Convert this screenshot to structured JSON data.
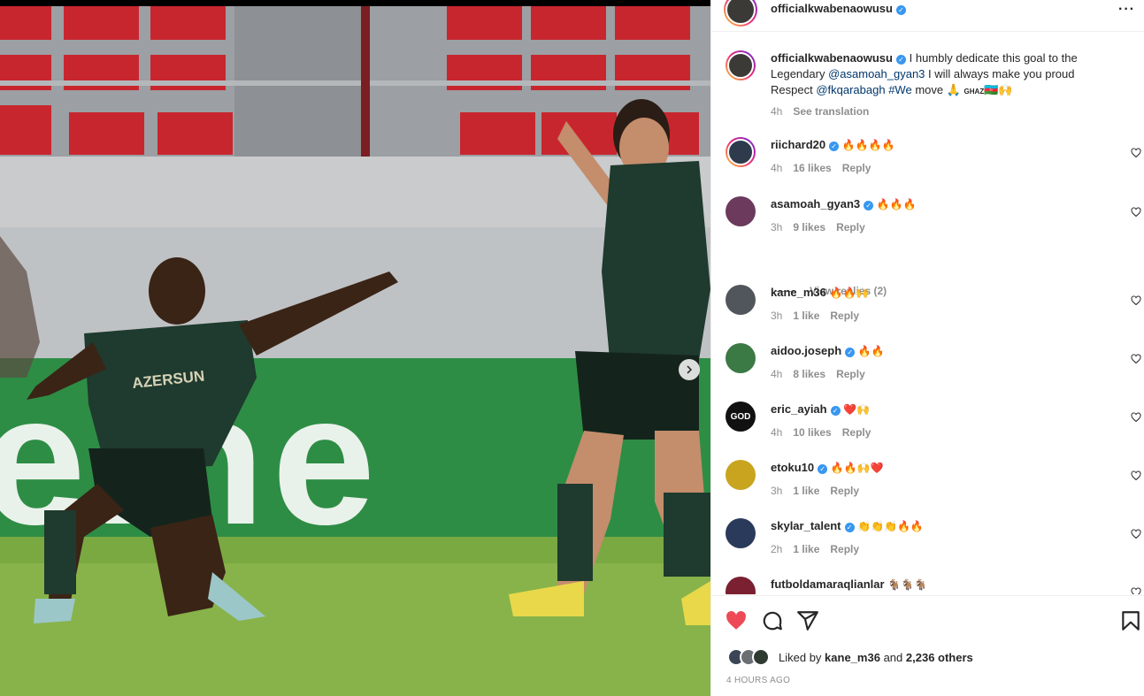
{
  "post": {
    "author": "officialkwabenaowusu",
    "caption_lines": [
      "I humbly dedicate this goal to the",
      "Legendary",
      "@asamoah_gyan3",
      "I will always make you proud",
      "Respect",
      "@fkqarabagh",
      "#We",
      "move 🙏",
      "GHAZ",
      "🇦🇿🙌"
    ],
    "caption_time": "4h",
    "see_translation": "See translation",
    "jersey_text": "AZERSUN",
    "banner_text": "eine"
  },
  "comments": [
    {
      "user": "riichard20",
      "verified": true,
      "text": "🔥🔥🔥🔥",
      "time": "4h",
      "likes": "16 likes",
      "reply": "Reply"
    },
    {
      "user": "asamoah_gyan3",
      "verified": true,
      "text": "🔥🔥🔥",
      "time": "3h",
      "likes": "9 likes",
      "reply": "Reply"
    },
    {
      "user": "kane_m36",
      "verified": false,
      "text": "🔥🔥🙌",
      "time": "3h",
      "likes": "1 like",
      "reply": "Reply"
    },
    {
      "user": "aidoo.joseph",
      "verified": true,
      "text": "🔥🔥",
      "time": "4h",
      "likes": "8 likes",
      "reply": "Reply"
    },
    {
      "user": "eric_ayiah",
      "verified": true,
      "text": "❤️🙌",
      "time": "4h",
      "likes": "10 likes",
      "reply": "Reply",
      "avatar_label": "GOD"
    },
    {
      "user": "etoku10",
      "verified": true,
      "text": "🔥🔥🙌❤️",
      "time": "3h",
      "likes": "1 like",
      "reply": "Reply"
    },
    {
      "user": "skylar_talent",
      "verified": true,
      "text": "👏👏👏🔥🔥",
      "time": "2h",
      "likes": "1 like",
      "reply": "Reply"
    },
    {
      "user": "futboldamaraqlianlar",
      "verified": false,
      "text": "🐐🐐🐐",
      "time": "",
      "likes": "",
      "reply": ""
    }
  ],
  "view_replies": "View replies (2)",
  "likes": {
    "prefix": "Liked by",
    "user": "kane_m36",
    "joiner": "and",
    "others": "2,236 others"
  },
  "timestamp": "4 HOURS AGO",
  "icons": {
    "like": "heart-filled-icon",
    "comment": "comment-icon",
    "share": "share-icon",
    "save": "bookmark-icon",
    "more": "more-options-icon",
    "next": "chevron-right-icon"
  },
  "colors": {
    "like_red": "#ed4956",
    "verified_blue": "#3897f0",
    "mention": "#00376b",
    "meta_gray": "#8e8e8e"
  }
}
